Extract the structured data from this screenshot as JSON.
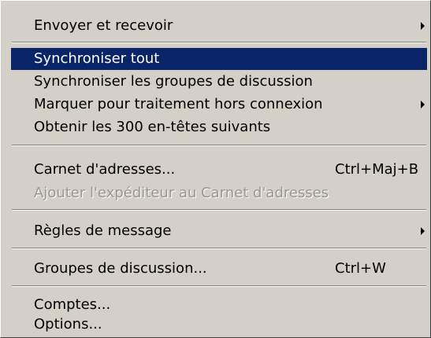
{
  "menu": {
    "items": [
      {
        "label": "Envoyer et recevoir",
        "shortcut": "",
        "submenu": true,
        "selected": false,
        "disabled": false
      },
      {
        "label": "Synchroniser tout",
        "shortcut": "",
        "submenu": false,
        "selected": true,
        "disabled": false
      },
      {
        "label": "Synchroniser les groupes de discussion",
        "shortcut": "",
        "submenu": false,
        "selected": false,
        "disabled": false
      },
      {
        "label": "Marquer pour traitement hors connexion",
        "shortcut": "",
        "submenu": true,
        "selected": false,
        "disabled": false
      },
      {
        "label": "Obtenir les 300 en-têtes suivants",
        "shortcut": "",
        "submenu": false,
        "selected": false,
        "disabled": false
      },
      {
        "label": "Carnet d'adresses...",
        "shortcut": "Ctrl+Maj+B",
        "submenu": false,
        "selected": false,
        "disabled": false
      },
      {
        "label": "Ajouter l'expéditeur au Carnet d'adresses",
        "shortcut": "",
        "submenu": false,
        "selected": false,
        "disabled": true
      },
      {
        "label": "Règles de message",
        "shortcut": "",
        "submenu": true,
        "selected": false,
        "disabled": false
      },
      {
        "label": "Groupes de discussion...",
        "shortcut": "Ctrl+W",
        "submenu": false,
        "selected": false,
        "disabled": false
      },
      {
        "label": "Comptes...",
        "shortcut": "",
        "submenu": false,
        "selected": false,
        "disabled": false
      },
      {
        "label": "Options...",
        "shortcut": "",
        "submenu": false,
        "selected": false,
        "disabled": false
      }
    ]
  },
  "colors": {
    "menu_background": "#d4d0c8",
    "selection_background": "#0a246a",
    "selection_text": "#ffffff",
    "disabled_text": "#9a9790"
  }
}
